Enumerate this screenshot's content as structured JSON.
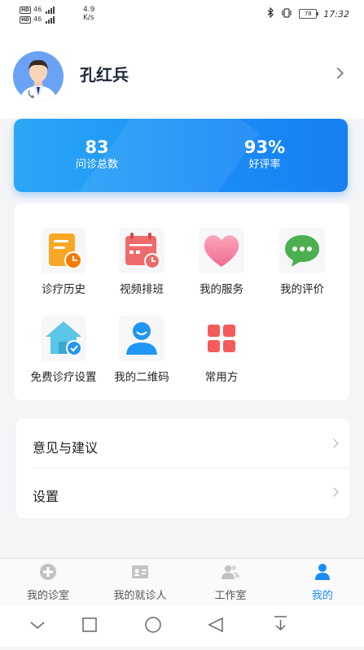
{
  "status_bar": {
    "left_row1": "46",
    "left_row2": "46",
    "speed_value": "4.9",
    "speed_unit": "K/s",
    "battery": "78",
    "time": "17:32"
  },
  "profile": {
    "name": "孔红兵"
  },
  "stats": [
    {
      "value": "83",
      "label": "问诊总数"
    },
    {
      "value": "93%",
      "label": "好评率"
    }
  ],
  "features": [
    {
      "label": "诊疗历史",
      "icon": "clipboard-clock-icon"
    },
    {
      "label": "视频排班",
      "icon": "calendar-clock-icon"
    },
    {
      "label": "我的服务",
      "icon": "heart-icon"
    },
    {
      "label": "我的评价",
      "icon": "chat-bubble-icon"
    },
    {
      "label": "免费诊疗设置",
      "icon": "house-check-icon"
    },
    {
      "label": "我的二维码",
      "icon": "user-qrcode-icon"
    },
    {
      "label": "常用方",
      "icon": "grid-squares-icon"
    }
  ],
  "menu": [
    {
      "label": "意见与建议"
    },
    {
      "label": "设置"
    }
  ],
  "tabs": [
    {
      "label": "我的诊室",
      "icon": "plus-circle-icon",
      "active": false
    },
    {
      "label": "我的就诊人",
      "icon": "id-card-icon",
      "active": false
    },
    {
      "label": "工作室",
      "icon": "users-icon",
      "active": false
    },
    {
      "label": "我的",
      "icon": "person-icon",
      "active": true
    }
  ],
  "colors": {
    "accent": "#1a8cf7",
    "card_gradient_start": "#2aa8f6",
    "card_gradient_end": "#187ff1",
    "background": "#f4f5f7"
  }
}
